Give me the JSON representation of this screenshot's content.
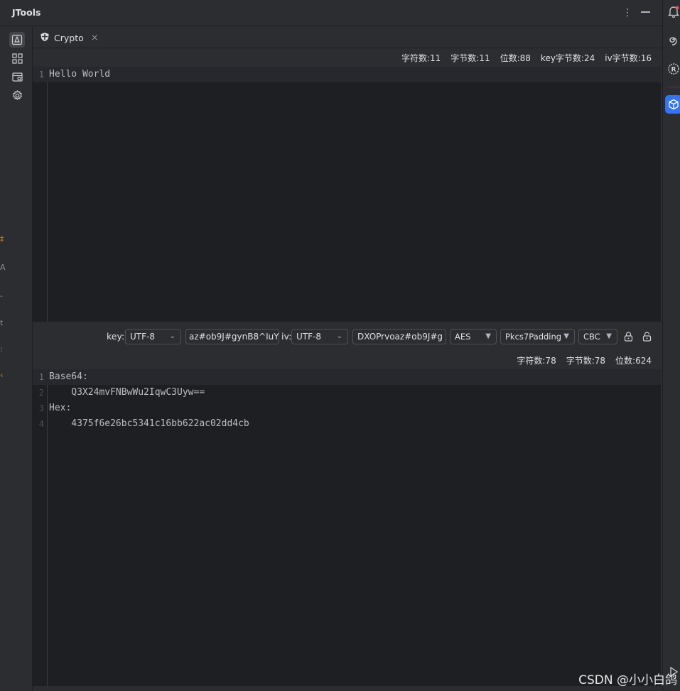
{
  "app": {
    "title": "JTools"
  },
  "tab": {
    "label": "Crypto",
    "close": "×"
  },
  "input_stats": {
    "chars": "字符数:11",
    "bytes": "字节数:11",
    "bits": "位数:88",
    "key_bytes": "key字节数:24",
    "iv_bytes": "iv字节数:16"
  },
  "input_editor": {
    "lines": [
      {
        "num": "1",
        "text": "Hello World"
      }
    ]
  },
  "controls": {
    "key_label": "key:",
    "key_encoding": "UTF-8",
    "key_value": "az#ob9J#gynB8^IuY",
    "iv_label": "iv:",
    "iv_encoding": "UTF-8",
    "iv_value": "DXOPrvoaz#ob9J#g",
    "algorithm": "AES",
    "padding": "Pkcs7Padding",
    "mode": "CBC"
  },
  "output_stats": {
    "chars": "字符数:78",
    "bytes": "字节数:78",
    "bits": "位数:624"
  },
  "output_editor": {
    "lines": [
      {
        "num": "1",
        "text": "Base64:"
      },
      {
        "num": "2",
        "text": "    Q3X24mvFNBwWu2IqwC3Uyw=="
      },
      {
        "num": "3",
        "text": "Hex:"
      },
      {
        "num": "4",
        "text": "    4375f6e26bc5341c16bb622ac02dd4cb"
      }
    ]
  },
  "watermark": "CSDN @小小白鸽",
  "icons": {
    "more": "more-vertical-icon",
    "minimize": "minimize-icon",
    "crypto_tab": "shield-icon",
    "tools": [
      "crypto-icon",
      "grid-icon",
      "calendar-icon",
      "gear-icon"
    ],
    "right": [
      "bell-icon",
      "swirl-icon",
      "rust-icon",
      "cube-icon",
      "play-icon"
    ]
  },
  "colors": {
    "accent": "#3574f0",
    "editor_bg": "#1e1f22",
    "panel_bg": "#2b2d30"
  }
}
